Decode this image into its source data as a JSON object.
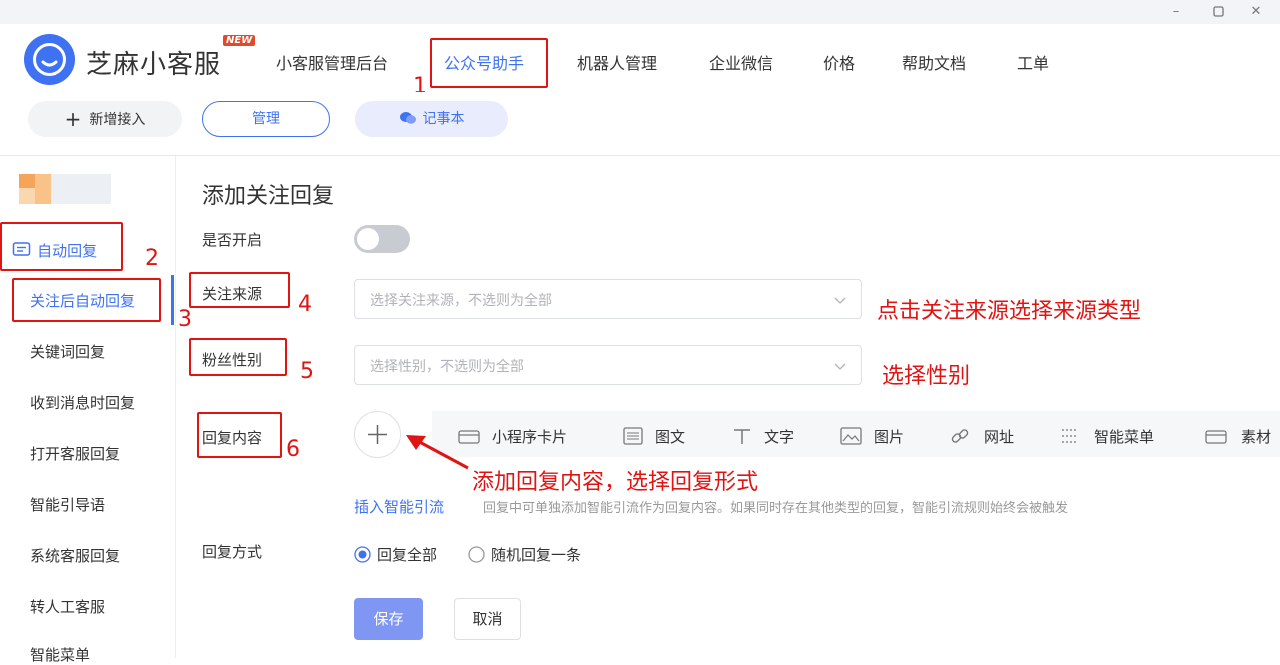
{
  "window": {
    "minimize_icon": "minimize-icon",
    "maximize_icon": "maximize-icon",
    "close_icon": "close-icon"
  },
  "brand": {
    "name": "芝麻小客服",
    "badge": "NEW"
  },
  "nav": {
    "items": [
      {
        "label": "小客服管理后台"
      },
      {
        "label": "公众号助手",
        "active": true
      },
      {
        "label": "机器人管理"
      },
      {
        "label": "企业微信"
      },
      {
        "label": "价格"
      },
      {
        "label": "帮助文档"
      },
      {
        "label": "工单"
      }
    ]
  },
  "toolbar": {
    "add_access": "新增接入",
    "manage": "管理",
    "notebook": "记事本"
  },
  "sidebar": {
    "group_title": "自动回复",
    "items": [
      {
        "label": "关注后自动回复",
        "active": true
      },
      {
        "label": "关键词回复"
      },
      {
        "label": "收到消息时回复"
      },
      {
        "label": "打开客服回复"
      },
      {
        "label": "智能引导语"
      },
      {
        "label": "系统客服回复"
      },
      {
        "label": "转人工客服"
      },
      {
        "label": "智能菜单"
      }
    ]
  },
  "page": {
    "title": "添加关注回复",
    "enable_label": "是否开启",
    "enable_value": false,
    "source_label": "关注来源",
    "source_placeholder": "选择关注来源，不选则为全部",
    "gender_label": "粉丝性别",
    "gender_placeholder": "选择性别，不选则为全部",
    "content_label": "回复内容",
    "content_types": [
      {
        "label": "小程序卡片",
        "icon": "mini-program-card-icon"
      },
      {
        "label": "图文",
        "icon": "article-icon"
      },
      {
        "label": "文字",
        "icon": "text-icon"
      },
      {
        "label": "图片",
        "icon": "image-icon"
      },
      {
        "label": "网址",
        "icon": "link-icon"
      },
      {
        "label": "智能菜单",
        "icon": "menu-icon"
      },
      {
        "label": "素材",
        "icon": "material-icon"
      }
    ],
    "insert_flow_link": "插入智能引流",
    "insert_flow_hint": "回复中可单独添加智能引流作为回复内容。如果同时存在其他类型的回复，智能引流规则始终会被触发",
    "mode_label": "回复方式",
    "mode_options": [
      {
        "label": "回复全部",
        "checked": true
      },
      {
        "label": "随机回复一条",
        "checked": false
      }
    ],
    "save": "保存",
    "cancel": "取消"
  },
  "annotations": {
    "n1": "1",
    "n2": "2",
    "n3": "3",
    "n4": "4",
    "n5": "5",
    "n6": "6",
    "source_note": "点击关注来源选择来源类型",
    "gender_note": "选择性别",
    "content_note": "添加回复内容，选择回复形式"
  },
  "colors": {
    "primary": "#3f72f3",
    "annotation_red": "#e11414",
    "save_button": "#7f96f2"
  }
}
